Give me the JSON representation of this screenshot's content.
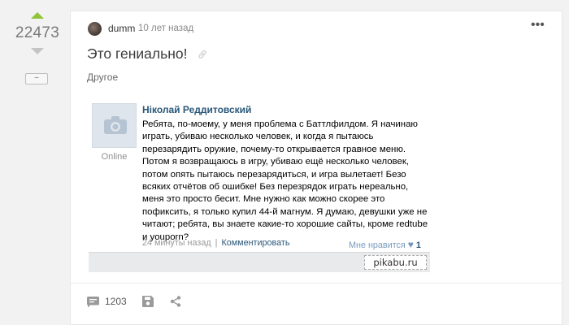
{
  "vote": {
    "rating": "22473",
    "collapse_label": "−"
  },
  "post": {
    "author": "dumm",
    "time": "10 лет назад",
    "more_label": "•••",
    "title": "Это гениально!",
    "tag": "Другое"
  },
  "embed": {
    "name": "Ніколай Реддитовский",
    "status": "Online",
    "text": "Ребята, по-моему, у меня проблема с Баттлфилдом. Я начинаю играть, убиваю несколько человек, и когда я пытаюсь перезарядить оружие, почему-то открывается гравное меню. Потом я возвращаюсь в игру, убиваю ещё несколько человек, потом опять пытаюсь перезарядиться, и игра вылетает! Безо всяких отчётов об ошибке! Без перезрядок играть нереально, меня это просто бесит. Мне нужно как можно скорее это пофиксить, я только купил 44-й магнум. Я думаю, девушки уже не читают; ребята, вы знаете какие-то хорошие сайты, кроме redtube и youporn?",
    "time_ago": "24 минуты назад",
    "separator": "|",
    "reply_label": "Комментировать",
    "like_label": "Мне нравится",
    "like_icon": "♥",
    "like_count": "1",
    "watermark": "pikabu.ru"
  },
  "footer": {
    "comments_count": "1203"
  },
  "colors": {
    "upvote": "#8fc43a",
    "downvote": "#c4c4c4",
    "vk_link": "#2b587a"
  }
}
